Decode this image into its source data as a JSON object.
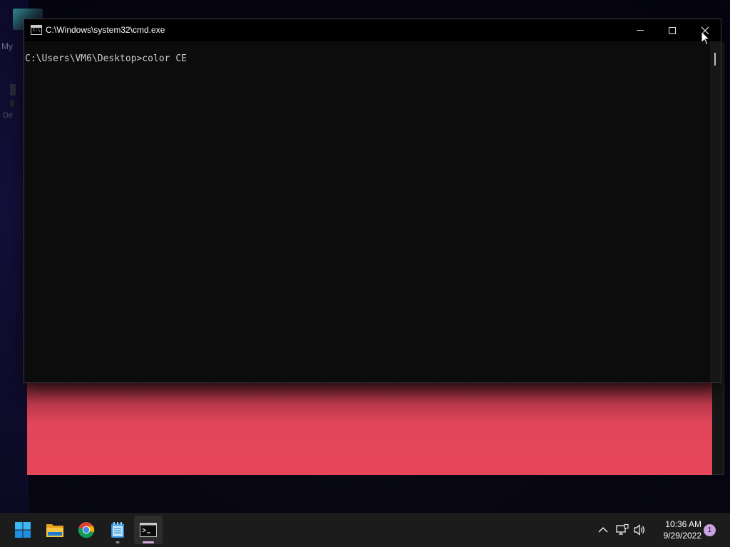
{
  "desktop": {
    "icon_label_partial": "My",
    "icon_label_partial_2": "De"
  },
  "cmd_window": {
    "title": "C:\\Windows\\system32\\cmd.exe",
    "icon_prompt": "C:\\",
    "console_text": "C:\\Users\\VM6\\Desktop>color CE",
    "controls": {
      "minimize": "minimize",
      "maximize": "maximize",
      "close": "close"
    }
  },
  "taskbar": {
    "apps": [
      {
        "name": "Start",
        "icon": "windows-start-icon"
      },
      {
        "name": "File Explorer",
        "icon": "folder-icon",
        "running": false
      },
      {
        "name": "Google Chrome",
        "icon": "chrome-icon",
        "running": false
      },
      {
        "name": "Notepad",
        "icon": "notepad-icon",
        "running": true
      },
      {
        "name": "Command Prompt",
        "icon": "terminal-icon",
        "running": true,
        "active": true
      }
    ],
    "tray": {
      "time": "10:36 AM",
      "date": "9/29/2022",
      "notification_count": "1"
    }
  },
  "colors": {
    "accent_red": "#e64659",
    "console_bg": "#0c0c0c",
    "taskbar_bg": "#1c1c1c",
    "notif_badge": "#c9a2e2"
  }
}
